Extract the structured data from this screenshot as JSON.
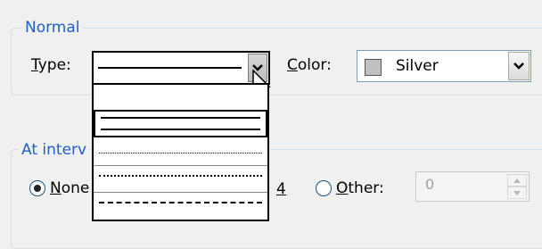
{
  "normal_group": {
    "title": "Normal",
    "type_label": "Type:",
    "color_label": "Color:",
    "color_value": "Silver",
    "color_swatch": "#c0c0c0"
  },
  "interval_group": {
    "title": "At interv",
    "none_label": "None",
    "count_value": "4",
    "other_label": "Other:",
    "other_value": "0"
  },
  "line_styles": [
    "solid-single",
    "solid-double",
    "dotted-fine",
    "dotted-sparse",
    "dashed"
  ],
  "accent_color": "#1f5fc6"
}
